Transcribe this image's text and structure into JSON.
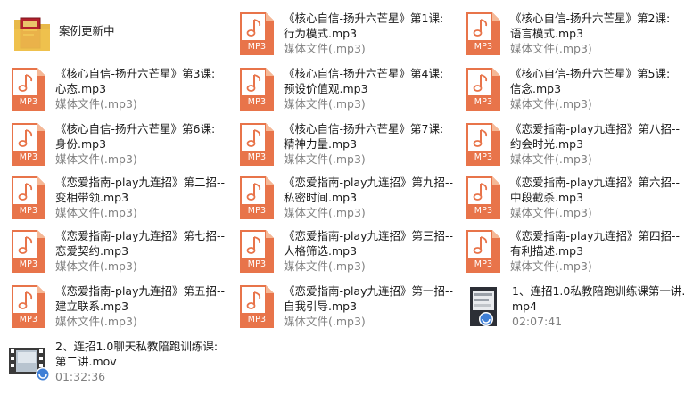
{
  "folder": {
    "name": "案例更新中"
  },
  "mp3_badge": "MP3",
  "files": [
    {
      "l1": "《核心自信-扬升六芒星》第1课:",
      "l2": "行为模式.mp3",
      "meta": "媒体文件(.mp3)"
    },
    {
      "l1": "《核心自信-扬升六芒星》第2课:",
      "l2": "语言模式.mp3",
      "meta": "媒体文件(.mp3)"
    },
    {
      "l1": "《核心自信-扬升六芒星》第3课:",
      "l2": "心态.mp3",
      "meta": "媒体文件(.mp3)"
    },
    {
      "l1": "《核心自信-扬升六芒星》第4课:",
      "l2": "预设价值观.mp3",
      "meta": "媒体文件(.mp3)"
    },
    {
      "l1": "《核心自信-扬升六芒星》第5课:",
      "l2": "信念.mp3",
      "meta": "媒体文件(.mp3)"
    },
    {
      "l1": "《核心自信-扬升六芒星》第6课:",
      "l2": "身份.mp3",
      "meta": "媒体文件(.mp3)"
    },
    {
      "l1": "《核心自信-扬升六芒星》第7课:",
      "l2": "精神力量.mp3",
      "meta": "媒体文件(.mp3)"
    },
    {
      "l1": "《恋爱指南-play九连招》第八招--",
      "l2": "约会时光.mp3",
      "meta": "媒体文件(.mp3)"
    },
    {
      "l1": "《恋爱指南-play九连招》第二招--",
      "l2": "变相带领.mp3",
      "meta": "媒体文件(.mp3)"
    },
    {
      "l1": "《恋爱指南-play九连招》第九招--",
      "l2": "私密时间.mp3",
      "meta": "媒体文件(.mp3)"
    },
    {
      "l1": "《恋爱指南-play九连招》第六招--",
      "l2": "中段截杀.mp3",
      "meta": "媒体文件(.mp3)"
    },
    {
      "l1": "《恋爱指南-play九连招》第七招--",
      "l2": "恋爱契约.mp3",
      "meta": "媒体文件(.mp3)"
    },
    {
      "l1": "《恋爱指南-play九连招》第三招--",
      "l2": "人格筛选.mp3",
      "meta": "媒体文件(.mp3)"
    },
    {
      "l1": "《恋爱指南-play九连招》第四招--",
      "l2": "有利描述.mp3",
      "meta": "媒体文件(.mp3)"
    },
    {
      "l1": "《恋爱指南-play九连招》第五招--",
      "l2": "建立联系.mp3",
      "meta": "媒体文件(.mp3)"
    },
    {
      "l1": "《恋爱指南-play九连招》第一招--",
      "l2": "自我引导.mp3",
      "meta": "媒体文件(.mp3)"
    }
  ],
  "videos": [
    {
      "l1": "1、连招1.0私教陪跑训练课第一讲.",
      "l2": "mp4",
      "meta": "02:07:41"
    },
    {
      "l1": "2、连招1.0聊天私教陪跑训练课:",
      "l2": "第二讲.mov",
      "meta": "01:32:36"
    }
  ],
  "colors": {
    "accent": "#e8744a",
    "meta_text": "#808080",
    "folder_red": "#b3202c"
  }
}
